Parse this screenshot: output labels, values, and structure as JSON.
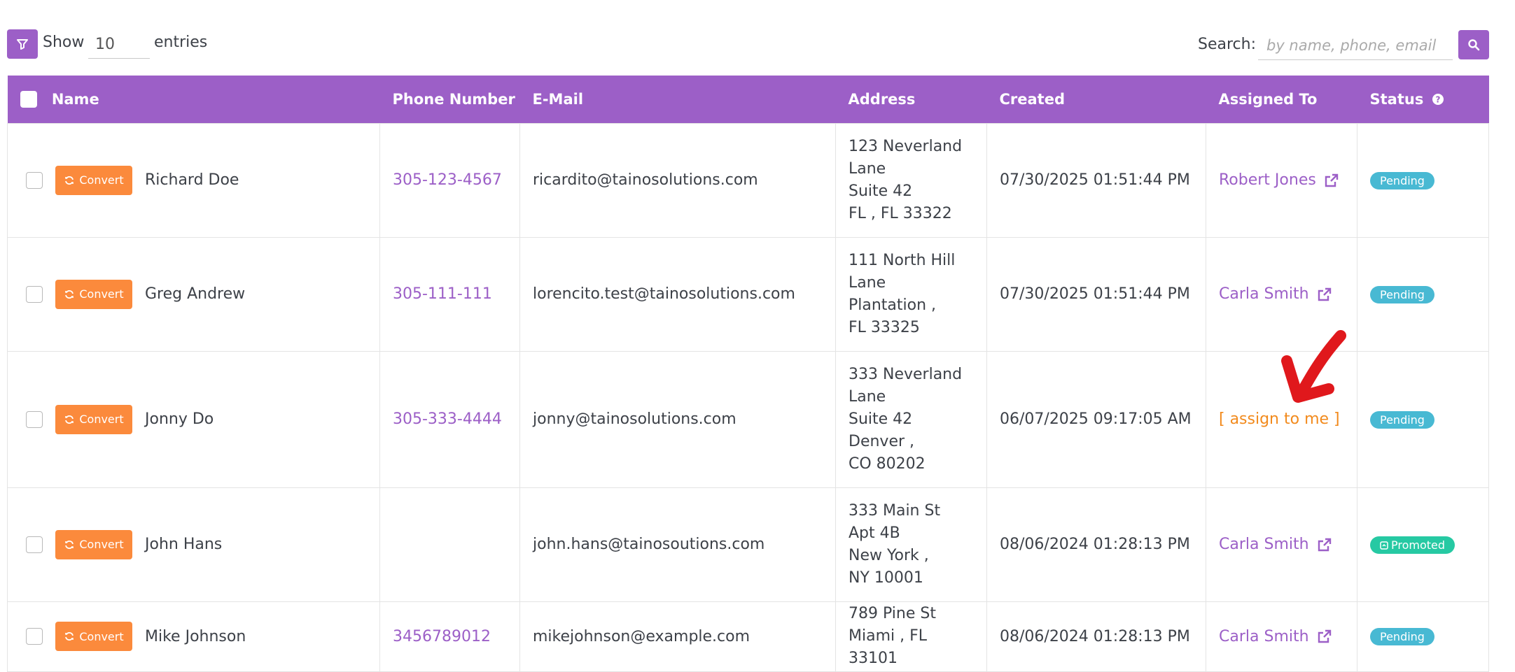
{
  "toolbar": {
    "show_label": "Show",
    "entries_value": "10",
    "entries_label": "entries",
    "search_label": "Search:",
    "search_placeholder": "by name, phone, email"
  },
  "table": {
    "headers": [
      "Name",
      "Phone Number",
      "E-Mail",
      "Address",
      "Created",
      "Assigned To",
      "Status"
    ],
    "convert_label": "Convert",
    "rows": [
      {
        "name": "Richard Doe",
        "phone": "305-123-4567",
        "email": "ricardito@tainosolutions.com",
        "address": [
          "123 Neverland",
          "Lane",
          "Suite 42",
          "FL , FL 33322"
        ],
        "created": "07/30/2025 01:51:44 PM",
        "assigned": "Robert Jones",
        "status": "Pending"
      },
      {
        "name": "Greg Andrew",
        "phone": "305-111-111",
        "email": "lorencito.test@tainosolutions.com",
        "address": [
          "111 North Hill",
          "Lane",
          "Plantation ,",
          "FL 33325"
        ],
        "created": "07/30/2025 01:51:44 PM",
        "assigned": "Carla Smith",
        "status": "Pending"
      },
      {
        "name": "Jonny Do",
        "phone": "305-333-4444",
        "email": "jonny@tainosolutions.com",
        "address": [
          "333 Neverland",
          "Lane",
          "Suite 42",
          "Denver ,",
          "CO 80202"
        ],
        "created": "06/07/2025 09:17:05 AM",
        "assigned": "[ assign to me ]",
        "status": "Pending"
      },
      {
        "name": "John Hans",
        "phone": "",
        "email": "john.hans@tainosoutions.com",
        "address": [
          "333 Main St",
          "Apt 4B",
          "New York ,",
          "NY 10001"
        ],
        "created": "08/06/2024 01:28:13 PM",
        "assigned": "Carla Smith",
        "status": "Promoted"
      },
      {
        "name": "Mike Johnson",
        "phone": "3456789012",
        "email": "mikejohnson@example.com",
        "address": [
          "789 Pine St",
          "Miami , FL 33101"
        ],
        "created": "08/06/2024 01:28:13 PM",
        "assigned": "Carla Smith",
        "status": "Pending"
      }
    ]
  },
  "colors": {
    "accent": "#9c5fc7",
    "convert": "#fb8a3c",
    "pending": "#48b9d3",
    "promoted": "#26c9a3",
    "assign_me": "#f28a1c",
    "annotation": "#e0181c"
  },
  "icons": {
    "filter": "filter-icon",
    "search": "search-icon",
    "convert": "convert-icon",
    "external_link": "external-link-icon",
    "help": "help-icon",
    "annotation": "red-arrow-annotation"
  }
}
